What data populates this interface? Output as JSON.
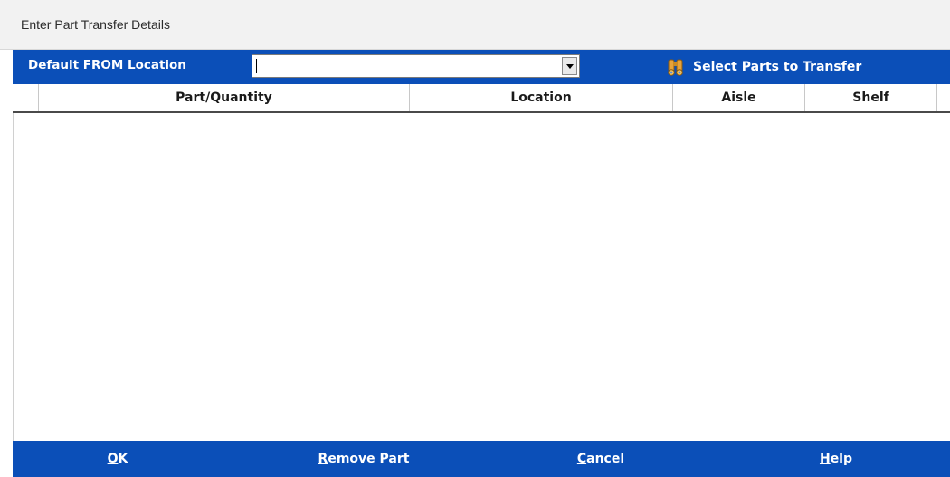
{
  "window": {
    "title": "Enter Part Transfer Details"
  },
  "toolbar": {
    "from_location_label": "Default FROM Location",
    "from_location_value": "",
    "select_parts": {
      "accel": "S",
      "rest": "elect Parts to Transfer",
      "icon": "binoculars-icon"
    }
  },
  "grid": {
    "columns": [
      "",
      "Part/Quantity",
      "Location",
      "Aisle",
      "Shelf"
    ],
    "rows": []
  },
  "footer": {
    "ok": {
      "accel": "O",
      "rest": "K"
    },
    "remove_part": {
      "accel": "R",
      "rest": "emove Part"
    },
    "cancel": {
      "accel": "C",
      "rest": "ancel"
    },
    "help": {
      "accel": "H",
      "rest": "elp"
    }
  },
  "colors": {
    "bar_blue": "#0b4fb8",
    "title_bg": "#f2f2f2",
    "text_white": "#ffffff"
  }
}
